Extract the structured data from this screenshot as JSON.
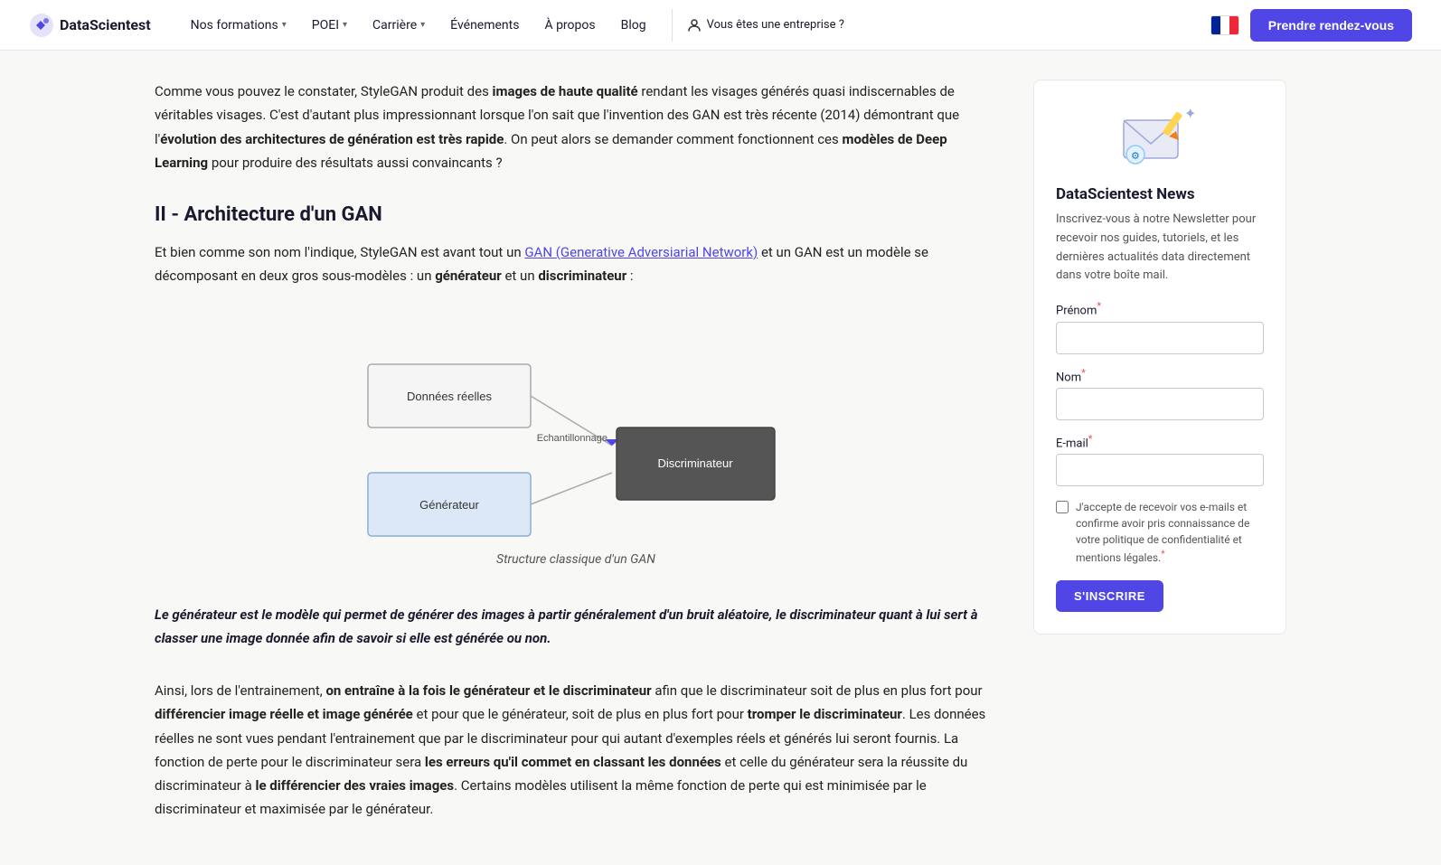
{
  "navbar": {
    "logo_text": "DataScientest",
    "nav_items": [
      {
        "label": "Nos formations",
        "has_dropdown": true
      },
      {
        "label": "POEI",
        "has_dropdown": true
      },
      {
        "label": "Carrière",
        "has_dropdown": true
      },
      {
        "label": "Événements",
        "has_dropdown": false
      },
      {
        "label": "À propos",
        "has_dropdown": false
      },
      {
        "label": "Blog",
        "has_dropdown": false
      }
    ],
    "enterprise_label": "Vous êtes une entreprise ?",
    "cta_label": "Prendre rendez-vous"
  },
  "article": {
    "intro": {
      "text_parts": [
        "Comme vous pouvez le constater, StyleGAN produit des ",
        "images de haute qualité",
        " rendant les visages générés quasi indiscernables de véritables visages. C'est d'autant plus impressionnant lorsque l'on sait que l'invention des GAN est très récente (2014) démontrant que l'",
        "évolution des architectures de génération est très rapide",
        ". On peut alors se demander comment fonctionnent ces ",
        "modèles de Deep Learning",
        " pour produire des résultats aussi convaincants ?"
      ]
    },
    "section_title": "II - Architecture d'un GAN",
    "section_intro": {
      "before_link": "Et bien comme son nom l'indique, StyleGAN est avant tout un ",
      "link_text": "GAN (Generative Adversiarial Network)",
      "after_link": " et un GAN est un modèle se décomposant en deux gros sous-modèles : un ",
      "bold1": "générateur",
      "between": " et un ",
      "bold2": "discriminateur",
      "end": " :"
    },
    "diagram": {
      "caption": "Structure classique d'un GAN",
      "box1_label": "Données réelles",
      "box2_label": "Générateur",
      "arrow_label": "Echantillonnage",
      "box3_label": "Discriminateur"
    },
    "blockquote": "Le générateur est le modèle qui permet de générer des images à partir généralement d'un bruit aléatoire, le discriminateur quant à lui sert à classer une image donnée afin de savoir si elle est générée ou non.",
    "body_paragraphs": [
      {
        "parts": [
          "Ainsi, lors de l'entrainement, ",
          "on entraîne à la fois le générateur et le discriminateur",
          " afin que le discriminateur soit de plus en plus fort pour ",
          "différencier image réelle et image générée",
          " et pour que le générateur, soit de plus en plus fort pour ",
          "tromper le discriminateur",
          ". Les données réelles ne sont vues pendant l'entrainement que par le discriminateur pour qui autant d'exemples réels et générés lui seront fournis. La fonction de perte pour le discriminateur sera ",
          "les erreurs qu'il commet en classant les données",
          " et celle du générateur sera la réussite du discriminateur à ",
          "le différencier des vraies images",
          ". Certains modèles utilisent la même fonction de perte qui est minimisée par le discriminateur et maximisée par le générateur."
        ]
      }
    ]
  },
  "sidebar": {
    "newsletter": {
      "title": "DataScientest News",
      "subtitle": "Inscrivez-vous à notre Newsletter pour recevoir nos guides, tutoriels, et les dernières actualités data directement dans votre boîte mail.",
      "fields": [
        {
          "label": "Prénom",
          "required": true,
          "name": "prenom"
        },
        {
          "label": "Nom",
          "required": true,
          "name": "nom"
        },
        {
          "label": "E-mail",
          "required": true,
          "name": "email"
        }
      ],
      "checkbox_text": "J'accepte de recevoir vos e-mails et confirme avoir pris connaissance de votre politique de confidentialité et mentions légales.",
      "subscribe_label": "S'INSCRIRE"
    }
  }
}
